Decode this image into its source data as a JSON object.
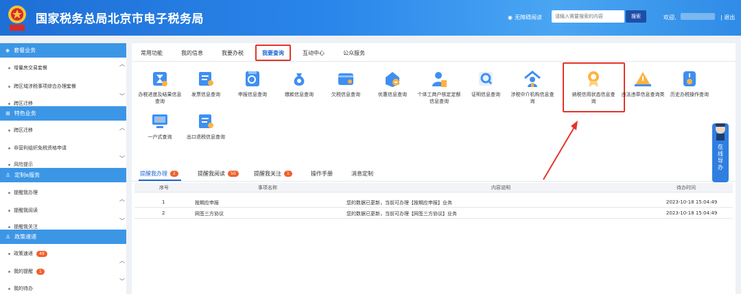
{
  "header": {
    "title": "国家税务总局北京市电子税务局",
    "accessibility": "无障碍阅读",
    "search_placeholder": "请输入需要搜索的内容",
    "search_button": "搜索",
    "welcome": "欢迎,",
    "logout": "退出",
    "accent_color": "#2a86ea"
  },
  "sidebar": {
    "sections": [
      {
        "title": "套餐业务",
        "icon": "stack-icon",
        "items": [
          "增量房交易套餐",
          "跨区域涉税事项综合办理套餐",
          "跨区迁移"
        ]
      },
      {
        "title": "特色业务",
        "icon": "grid-icon",
        "items": [
          "跨区迁移",
          "非营利组织免税资格申请",
          "风险提示"
        ]
      },
      {
        "title": "定制e服务",
        "icon": "user-icon",
        "items": [
          "提醒我办理",
          "提醒我阅读",
          "提醒我关注"
        ]
      },
      {
        "title": "政策速递",
        "icon": "user-icon",
        "items": [
          "政策速递",
          "我的提醒",
          "我的待办"
        ],
        "badges": [
          "49",
          "1",
          ""
        ]
      }
    ]
  },
  "main": {
    "tabs": [
      "常用功能",
      "我的信息",
      "我要办税",
      "我要查询",
      "互动中心",
      "公众服务"
    ],
    "active_tab": "我要查询",
    "grid": [
      {
        "label": "办税进度及结果信息查询",
        "icon": "hourglass-icon"
      },
      {
        "label": "发票信息查询",
        "icon": "invoice-icon"
      },
      {
        "label": "申报信息查询",
        "icon": "report-icon"
      },
      {
        "label": "缴款信息查询",
        "icon": "money-bag-icon"
      },
      {
        "label": "欠税信息查询",
        "icon": "arrears-icon"
      },
      {
        "label": "优惠信息查询",
        "icon": "discount-icon"
      },
      {
        "label": "个体工商户核定定额信息查询",
        "icon": "person-icon"
      },
      {
        "label": "证明信息查询",
        "icon": "certificate-icon"
      },
      {
        "label": "涉税中介机构信息查询",
        "icon": "agency-icon"
      },
      {
        "label": "纳税信用状态信息查询",
        "icon": "credit-medal-icon"
      },
      {
        "label": "违法违章信息查询类",
        "icon": "warning-icon"
      },
      {
        "label": "历史办税操作查询",
        "icon": "history-icon"
      },
      {
        "label": "一户式查询",
        "icon": "monitor-icon"
      },
      {
        "label": "出口退税信息查询",
        "icon": "export-refund-icon"
      }
    ],
    "lower_tabs": [
      {
        "label": "提醒我办理",
        "badge": "2"
      },
      {
        "label": "提醒我阅读",
        "badge": "50"
      },
      {
        "label": "提醒我关注",
        "badge": "1"
      },
      {
        "label": "操作手册",
        "badge": ""
      },
      {
        "label": "消息定制",
        "badge": ""
      }
    ],
    "table": {
      "headers": [
        "序号",
        "事项名称",
        "内容说明",
        "待办时间"
      ],
      "rows": [
        [
          "1",
          "按期应申报",
          "您的数据已更新，当前可办理【按期应申报】业务",
          "2023-10-18 15:04:49"
        ],
        [
          "2",
          "网签三方协议",
          "您的数据已更新，当前可办理【网签三方协议】业务",
          "2023-10-18 15:04:49"
        ]
      ]
    }
  },
  "float_help": {
    "chars": [
      "在",
      "线",
      "导",
      "办"
    ]
  }
}
